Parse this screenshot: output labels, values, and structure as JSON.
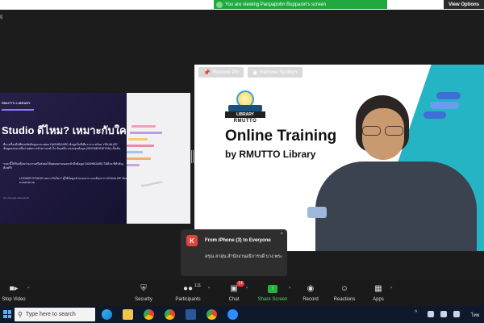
{
  "share_banner": {
    "text": "You are viewing Panpapohn Buppasiri's screen",
    "view_options": "View Options"
  },
  "window": {
    "label": "g"
  },
  "left_tile": {
    "brand": "RMUTTO LIBRARY",
    "headline": "Studio ดีไหม? เหมาะกับใคร?",
    "para1": "คือ เครื่องมือที่ช่วยจัดข้อมูลและแสดง DASHBOARD ข้อมูลในที่เดียว ทาง พร้อม VISUALIZE ข้อมูลออกมาเพื่อง่ายต่อการทำความเข้าใจ ข้อเหลือ แบ่งกลุ่มข้อมูล (SEGMENTATION) เป็นต้น",
    "para2": "ระยะนี้ให้กับเพื่อนร่วมงานหรือส่งต่อให้บุคคลภายนอกเข้าถึงข้อมูล DASHBOARD ได้ด้วย ที่สำคัญคือฟรี!!",
    "para3": "LOOKER STUDIO เหมาะกับใคร? ผู้ใช้ข้อมูลจำนวนมาก และต้องการ VISUALIZE ข้อมูลออกมาแบบสวยงาม",
    "footer": "ttps://google-data-studio",
    "chart_paper_text": "Documentation",
    "colors": {
      "slide_bg": "#1a1633",
      "accent": "#8b7cff"
    }
  },
  "right_tile": {
    "remove_pin": "Remove Pin",
    "remove_spotlight": "Remove Spotlight",
    "logo_library": "LIBRARY",
    "logo_rmutto": "RMUTTO",
    "title_main": "Online Training",
    "title_sub": "by RMUTTO Library",
    "colors": {
      "teal": "#25b4c4"
    }
  },
  "chat_notification": {
    "avatar_letter": "K",
    "sender": "From iPhone (3) to Everyone",
    "close": "×",
    "message": "อรุณ ลาสุน สำนักงานอธิการบดี บาง พระ"
  },
  "toolbar": {
    "items": [
      {
        "label": "Stop Video",
        "icon": "camera-icon"
      },
      {
        "label": "Security",
        "icon": "shield-icon"
      },
      {
        "label": "Participants",
        "icon": "people-icon",
        "count": "111"
      },
      {
        "label": "Chat",
        "icon": "chat-icon",
        "badge": "14"
      },
      {
        "label": "Share Screen",
        "icon": "share-screen-icon"
      },
      {
        "label": "Record",
        "icon": "record-icon"
      },
      {
        "label": "Reactions",
        "icon": "reactions-icon"
      },
      {
        "label": "Apps",
        "icon": "apps-icon"
      }
    ],
    "colors": {
      "share_green": "#26b13c",
      "badge_red": "#e0353a"
    }
  },
  "taskbar": {
    "search_placeholder": "Type here to search",
    "language": "ไทย",
    "apps": [
      "edge",
      "file-explorer",
      "chrome",
      "chrome-alt",
      "word",
      "chrome-profile",
      "zoom"
    ]
  }
}
